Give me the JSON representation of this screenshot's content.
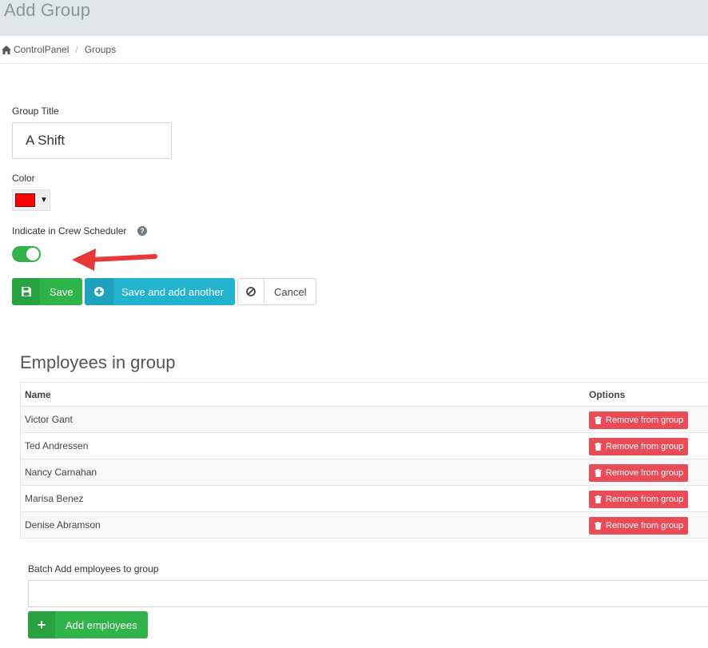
{
  "header": {
    "title": "Add Group"
  },
  "breadcrumb": {
    "home": "ControlPanel",
    "current": "Groups",
    "separator": "/"
  },
  "form": {
    "group_title_label": "Group Title",
    "group_title_value": "A Shift",
    "color_label": "Color",
    "color_value": "#ff0000",
    "color_caret": "▼",
    "crew_scheduler_label": "Indicate in Crew Scheduler",
    "help_glyph": "?",
    "crew_scheduler_enabled": true
  },
  "actions": {
    "save": "Save",
    "save_add": "Save and add another",
    "cancel": "Cancel"
  },
  "employees": {
    "title": "Employees in group",
    "col_name": "Name",
    "col_options": "Options",
    "remove_label": "Remove from group",
    "rows": [
      {
        "name": "Victor Gant"
      },
      {
        "name": "Ted Andressen"
      },
      {
        "name": "Nancy Carnahan"
      },
      {
        "name": "Marisa Benez"
      },
      {
        "name": "Denise Abramson"
      }
    ]
  },
  "batch": {
    "label": "Batch Add employees to group",
    "value": "",
    "add_button": "Add employees",
    "add_glyph": "+"
  },
  "colors": {
    "header_bg": "#e1e6e9",
    "success": "#2fb44a",
    "info": "#22b3cf",
    "danger": "#ea4c57",
    "arrow": "#e8393a"
  }
}
